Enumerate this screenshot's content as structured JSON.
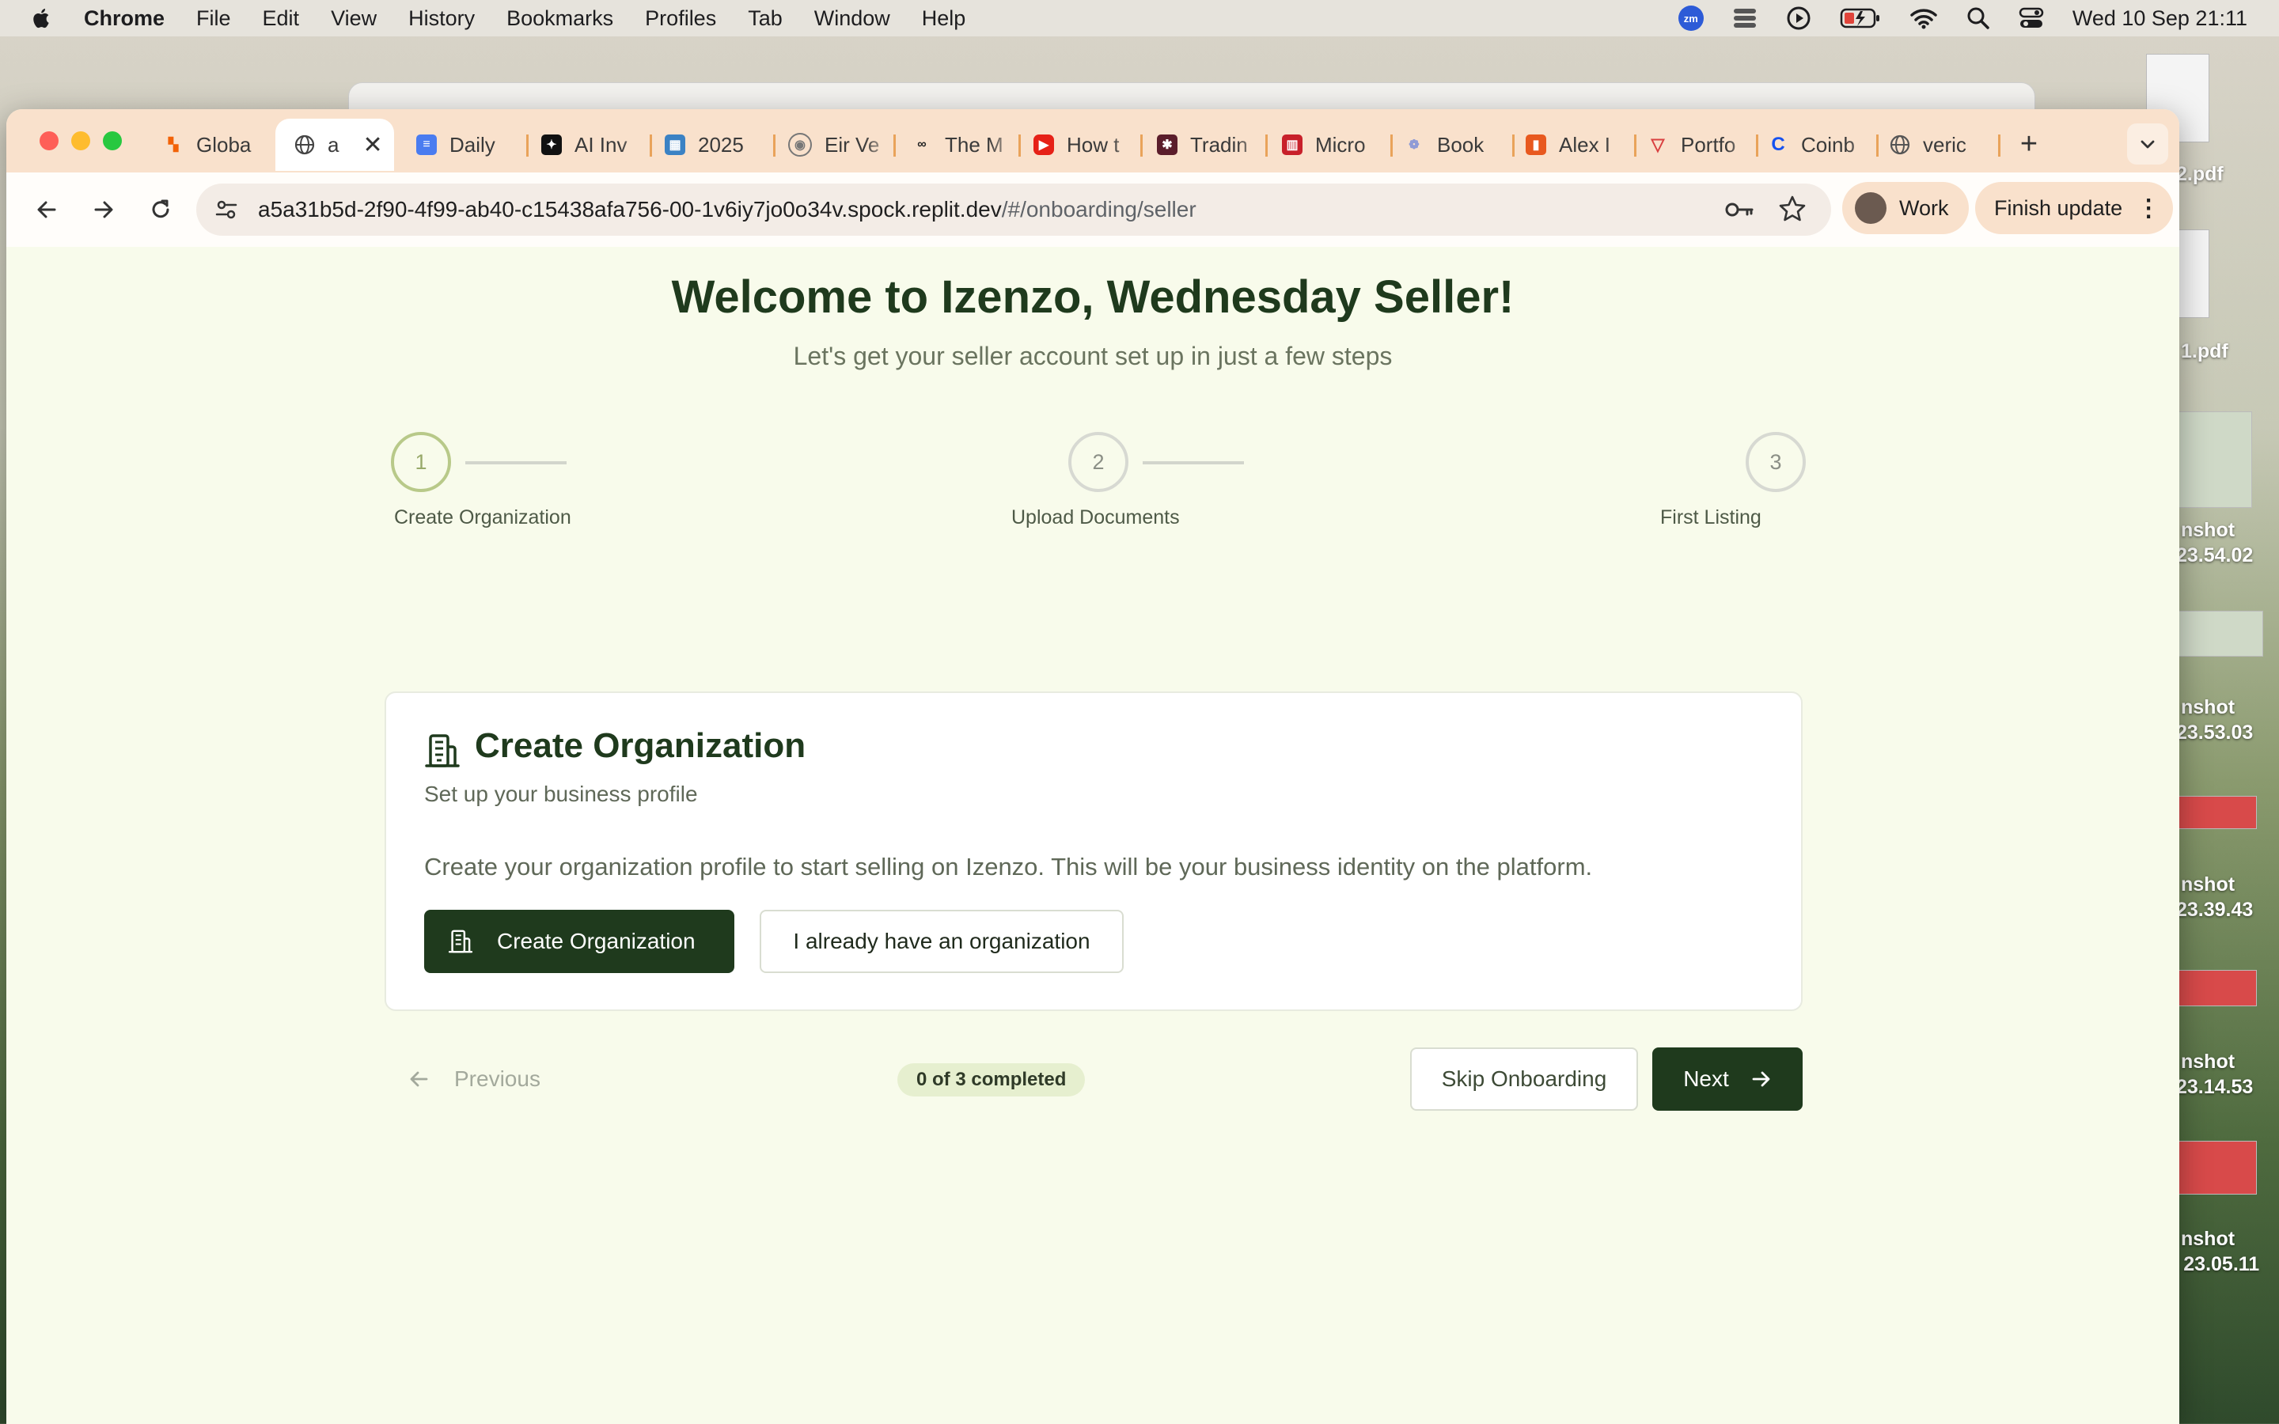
{
  "menubar": {
    "app": "Chrome",
    "items": [
      "File",
      "Edit",
      "View",
      "History",
      "Bookmarks",
      "Profiles",
      "Tab",
      "Window",
      "Help"
    ],
    "clock": "Wed 10 Sep  21:11",
    "zoom_badge": "zm"
  },
  "desktop_files": [
    {
      "label": "2.pdf"
    },
    {
      "label": "1.pdf"
    },
    {
      "label": "nshot",
      "sub": "23.54.02"
    },
    {
      "label": "nshot",
      "sub": "23.53.03"
    },
    {
      "label": "nshot",
      "sub": "23.39.43"
    },
    {
      "label": "nshot",
      "sub": "23.14.53"
    },
    {
      "label": "nshot",
      "sub": "t 23.05.11"
    }
  ],
  "tabs": [
    {
      "title": "Globa",
      "icon": "replit-icon",
      "color": "#f26207"
    },
    {
      "title": "a",
      "icon": "globe-icon",
      "color": "#555555",
      "active": true
    },
    {
      "title": "Daily",
      "icon": "docs-icon",
      "color": "#4a7cf0"
    },
    {
      "title": "AI Inv",
      "icon": "sparkle-icon",
      "color": "#111111"
    },
    {
      "title": "2025",
      "icon": "calendar-icon",
      "color": "#3b82c4"
    },
    {
      "title": "Eir Ve",
      "icon": "coin-icon",
      "color": "#777777"
    },
    {
      "title": "The M",
      "icon": "glasses-icon",
      "color": "#222222"
    },
    {
      "title": "How t",
      "icon": "youtube-icon",
      "color": "#e62117"
    },
    {
      "title": "Tradin",
      "icon": "tradingview-icon",
      "color": "#5b1d2b"
    },
    {
      "title": "Micro",
      "icon": "books-icon",
      "color": "#c8202a"
    },
    {
      "title": "Book",
      "icon": "circles-icon",
      "color": "#8f9bd6"
    },
    {
      "title": "Alex I",
      "icon": "bookmark-icon",
      "color": "#e8591f"
    },
    {
      "title": "Portfo",
      "icon": "triangle-icon",
      "color": "#d94040"
    },
    {
      "title": "Coinb",
      "icon": "coinbase-icon",
      "color": "#1652f0"
    },
    {
      "title": "veric",
      "icon": "globe-icon",
      "color": "#555555"
    }
  ],
  "toolbar": {
    "url_host": "a5a31b5d-2f90-4f99-ab40-c15438afa756-00-1v6iy7jo0o34v.spock.replit.dev",
    "url_path": "/#/onboarding/seller",
    "profile_label": "Work",
    "finish_update_label": "Finish update"
  },
  "page": {
    "title": "Welcome to Izenzo, Wednesday Seller!",
    "subtitle": "Let's get your seller account set up in just a few steps",
    "steps": [
      {
        "number": "1",
        "label": "Create Organization",
        "state": "active"
      },
      {
        "number": "2",
        "label": "Upload Documents",
        "state": "inactive"
      },
      {
        "number": "3",
        "label": "First Listing",
        "state": "inactive"
      }
    ],
    "card": {
      "title": "Create Organization",
      "subtitle": "Set up your business profile",
      "description": "Create your organization profile to start selling on Izenzo. This will be your business identity on the platform.",
      "primary_button": "Create Organization",
      "secondary_button": "I already have an organization"
    },
    "footer": {
      "previous_label": "Previous",
      "progress_label": "0 of 3 completed",
      "skip_label": "Skip Onboarding",
      "next_label": "Next"
    }
  },
  "colors": {
    "brand_dark": "#1f3a1d",
    "page_bg": "#f8fbeb",
    "step_active": "#b8c989",
    "tabstrip": "#f9e1cc"
  }
}
